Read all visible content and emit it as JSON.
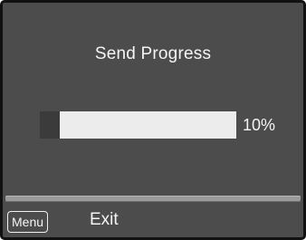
{
  "dialog": {
    "title": "Send Progress"
  },
  "progress": {
    "value_fraction": 0.1,
    "label": "10%",
    "fill_color": "#3b3b3b",
    "track_color": "#ececec"
  },
  "footer": {
    "menu_key_label": "Menu",
    "exit_label": "Exit"
  },
  "colors": {
    "screen_background": "#4c4c4c",
    "text": "#f4f4f4"
  }
}
